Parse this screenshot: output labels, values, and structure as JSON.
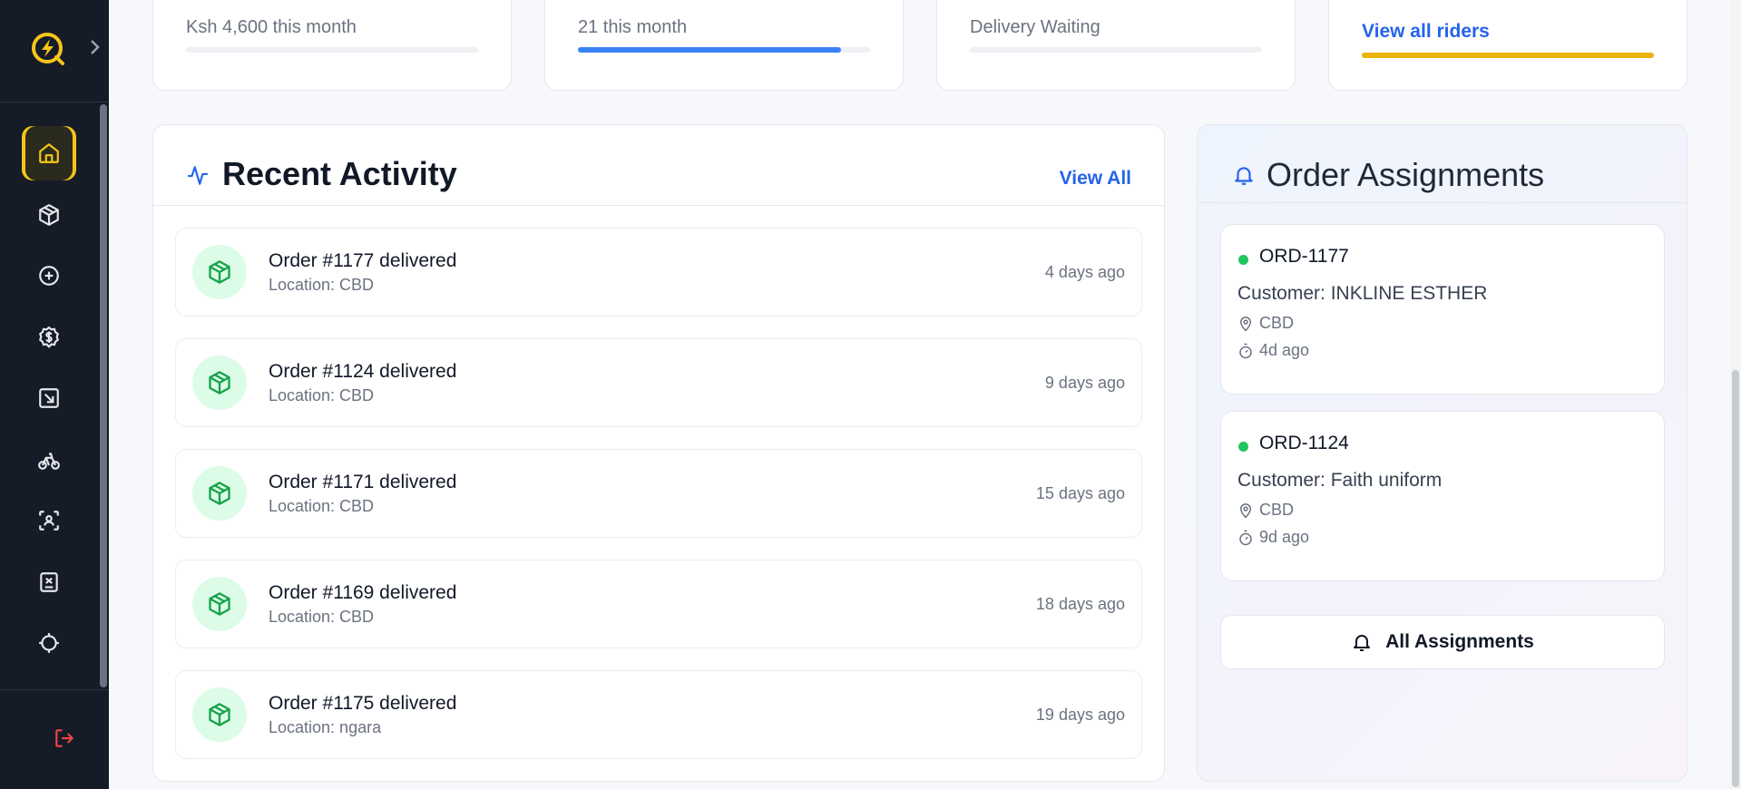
{
  "colors": {
    "accent": "#2563eb",
    "brand": "#f5c518",
    "success": "#22c55e",
    "danger": "#ef4444",
    "sidebar": "#151b27"
  },
  "sidebar": {
    "items": [
      {
        "icon": "home-icon",
        "active": true
      },
      {
        "icon": "package-icon"
      },
      {
        "icon": "plus-circle-icon"
      },
      {
        "icon": "dollar-circle-icon"
      },
      {
        "icon": "arrow-in-box-icon"
      },
      {
        "icon": "bike-icon"
      },
      {
        "icon": "scan-icon"
      },
      {
        "icon": "report-icon"
      },
      {
        "icon": "target-icon"
      }
    ],
    "logout_icon": "logout-icon"
  },
  "stats": [
    {
      "text": "Ksh 4,600 this month",
      "progress": 0.0
    },
    {
      "text": "21 this month",
      "progress": 0.9
    },
    {
      "text": "Delivery Waiting",
      "progress": 0.0
    },
    {
      "link": "View all riders",
      "progress": 1.0
    }
  ],
  "activity": {
    "title": "Recent Activity",
    "view_all": "View All",
    "items": [
      {
        "title": "Order #1177 delivered",
        "location": "Location: CBD",
        "time": "4 days ago"
      },
      {
        "title": "Order #1124 delivered",
        "location": "Location: CBD",
        "time": "9 days ago"
      },
      {
        "title": "Order #1171 delivered",
        "location": "Location: CBD",
        "time": "15 days ago"
      },
      {
        "title": "Order #1169 delivered",
        "location": "Location: CBD",
        "time": "18 days ago"
      },
      {
        "title": "Order #1175 delivered",
        "location": "Location: ngara",
        "time": "19 days ago"
      }
    ]
  },
  "assignments": {
    "title": "Order Assignments",
    "cards": [
      {
        "id": "ORD-1177",
        "customer": "Customer: INKLINE ESTHER",
        "location": "CBD",
        "time": "4d ago"
      },
      {
        "id": "ORD-1124",
        "customer": "Customer: Faith uniform",
        "location": "CBD",
        "time": "9d ago"
      }
    ],
    "all_button": "All Assignments"
  }
}
